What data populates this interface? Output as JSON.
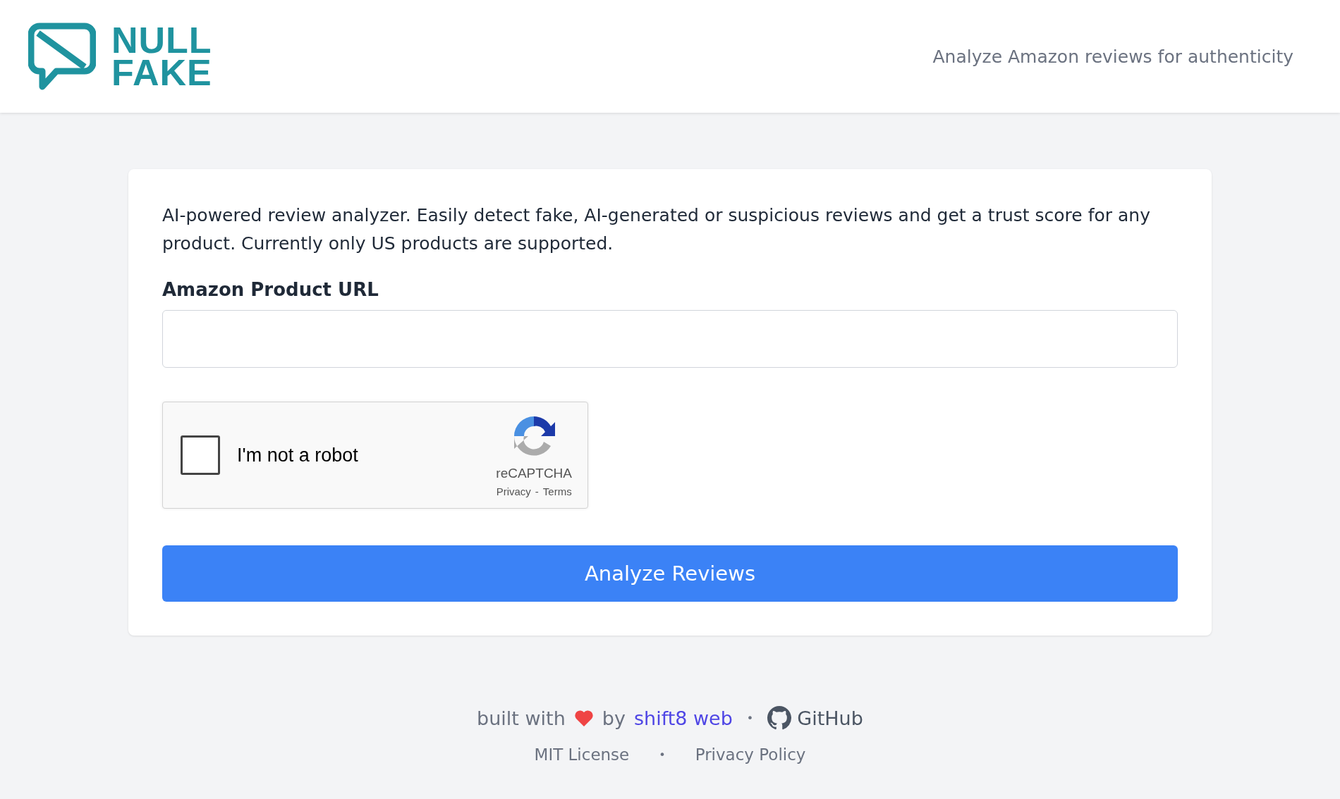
{
  "header": {
    "logo_lines": [
      "NULL",
      "FAKE"
    ],
    "tagline": "Analyze Amazon reviews for authenticity"
  },
  "form": {
    "description": "AI-powered review analyzer. Easily detect fake, AI-generated or suspicious reviews and get a trust score for any product. Currently only US products are supported.",
    "url_label": "Amazon Product URL",
    "captcha": {
      "checked": false,
      "label": "I'm not a robot",
      "brand": "reCAPTCHA",
      "privacy": "Privacy",
      "dash": "-",
      "terms": "Terms"
    },
    "submit": "Analyze Reviews"
  },
  "footer": {
    "built_with": "built with",
    "by": "by",
    "author_link": "shift8 web",
    "separator": "•",
    "github": "GitHub",
    "links": [
      {
        "kind": "link",
        "text": "MIT License"
      },
      {
        "kind": "separator",
        "text": "•"
      },
      {
        "kind": "link",
        "text": "Privacy Policy"
      }
    ]
  }
}
